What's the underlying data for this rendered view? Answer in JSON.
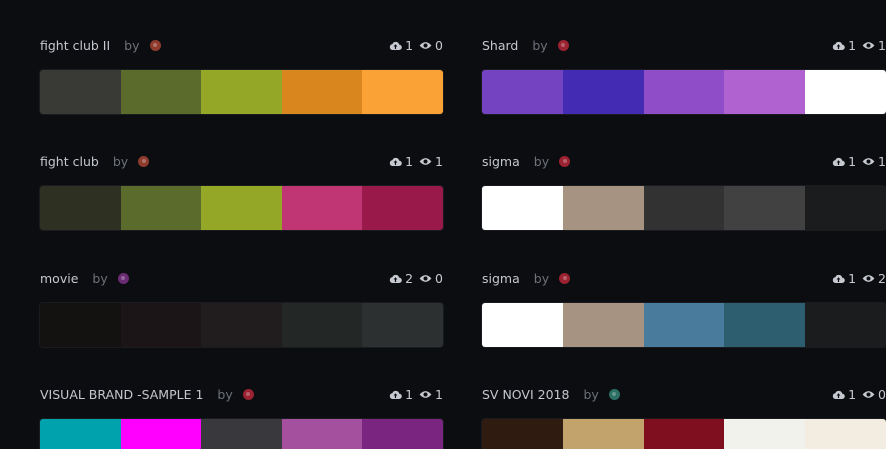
{
  "by_label": "by",
  "palettes": [
    {
      "title": "fight club II",
      "author_color": "#8e3b2e",
      "uploads": "1",
      "views": "0",
      "colors": [
        "#393a36",
        "#5a6b2b",
        "#95a726",
        "#d9861e",
        "#fba236"
      ]
    },
    {
      "title": "Shard",
      "author_color": "#9b2230",
      "uploads": "1",
      "views": "1",
      "colors": [
        "#7443c1",
        "#432cb3",
        "#8f4ec8",
        "#b162d1",
        "#ffffff"
      ]
    },
    {
      "title": "fight club",
      "author_color": "#8e3b2e",
      "uploads": "1",
      "views": "1",
      "colors": [
        "#2e3022",
        "#5a6b2b",
        "#95a726",
        "#c03574",
        "#99194a"
      ]
    },
    {
      "title": "sigma",
      "author_color": "#9b2230",
      "uploads": "1",
      "views": "1",
      "colors": [
        "#ffffff",
        "#a69382",
        "#333233",
        "#424142",
        "#1b1c1e"
      ]
    },
    {
      "title": "movie",
      "author_color": "#6a2b73",
      "uploads": "2",
      "views": "0",
      "colors": [
        "#141210",
        "#1c1517",
        "#211d1e",
        "#232827",
        "#2c3030"
      ]
    },
    {
      "title": "sigma",
      "author_color": "#9b2230",
      "uploads": "1",
      "views": "2",
      "colors": [
        "#ffffff",
        "#a69382",
        "#497b9c",
        "#2d5e70",
        "#1b1c1e"
      ]
    },
    {
      "title": "VISUAL BRAND -SAMPLE 1",
      "author_color": "#9b2230",
      "uploads": "1",
      "views": "1",
      "colors": [
        "#00a3ad",
        "#ff00ff",
        "#39383c",
        "#a54f9f",
        "#7a2680"
      ]
    },
    {
      "title": "SV NOVI 2018",
      "author_color": "#2c6f64",
      "uploads": "1",
      "views": "0",
      "colors": [
        "#2f1b10",
        "#c2a36b",
        "#7f0f1f",
        "#f2f2ec",
        "#f3ece0"
      ]
    }
  ]
}
